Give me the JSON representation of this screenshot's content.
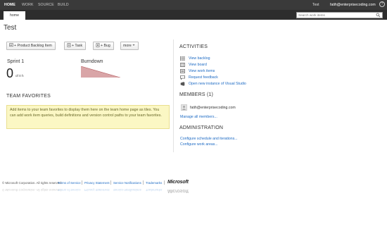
{
  "nav": {
    "items": [
      "HOME",
      "WORK",
      "SOURCE",
      "BUILD"
    ],
    "project": "Test",
    "user": "fatih@enterprisecoding.com",
    "help_symbol": "?"
  },
  "subnav": {
    "tab": "home",
    "search_placeholder": "Search work items"
  },
  "page": {
    "title": "Test"
  },
  "buttons": {
    "backlog": "+ Product Backlog Item",
    "task": "+ Task",
    "bug": "+ Bug",
    "more": "more"
  },
  "sprint": {
    "label": "Sprint 1",
    "value": "0",
    "of": "of 0 h"
  },
  "burndown": {
    "label": "Burndown"
  },
  "favorites": {
    "title": "TEAM FAVORITES",
    "message": "Add items to your team favorites to display them here on the team home page as tiles. You can add work item queries, build definitions and version control paths to your team favorites."
  },
  "activities": {
    "title": "ACTIVITIES",
    "items": [
      {
        "label": "View backlog",
        "icon": "backlog-icon"
      },
      {
        "label": "View board",
        "icon": "board-icon"
      },
      {
        "label": "View work items",
        "icon": "work-items-icon"
      },
      {
        "label": "Request feedback",
        "icon": "feedback-icon"
      },
      {
        "label": "Open new instance of Visual Studio",
        "icon": "visual-studio-icon"
      }
    ]
  },
  "members": {
    "title": "MEMBERS (1)",
    "name": "fatih@enterprisecoding.com",
    "manage": "Manage all members..."
  },
  "administration": {
    "title": "ADMINISTRATION",
    "schedule": "Configure schedule and iterations...",
    "areas": "Configure work areas..."
  },
  "footer": {
    "copyright": "© Microsoft Corporation. All rights reserved.",
    "links": [
      "Terms of Service",
      "Privacy Statement",
      "Service Notifications",
      "Trademarks"
    ],
    "logo": "Microsoft"
  },
  "colors": {
    "link": "#1e6bc4",
    "nav": "#3a3a3a",
    "favorites_bg": "#fbf7c4"
  }
}
